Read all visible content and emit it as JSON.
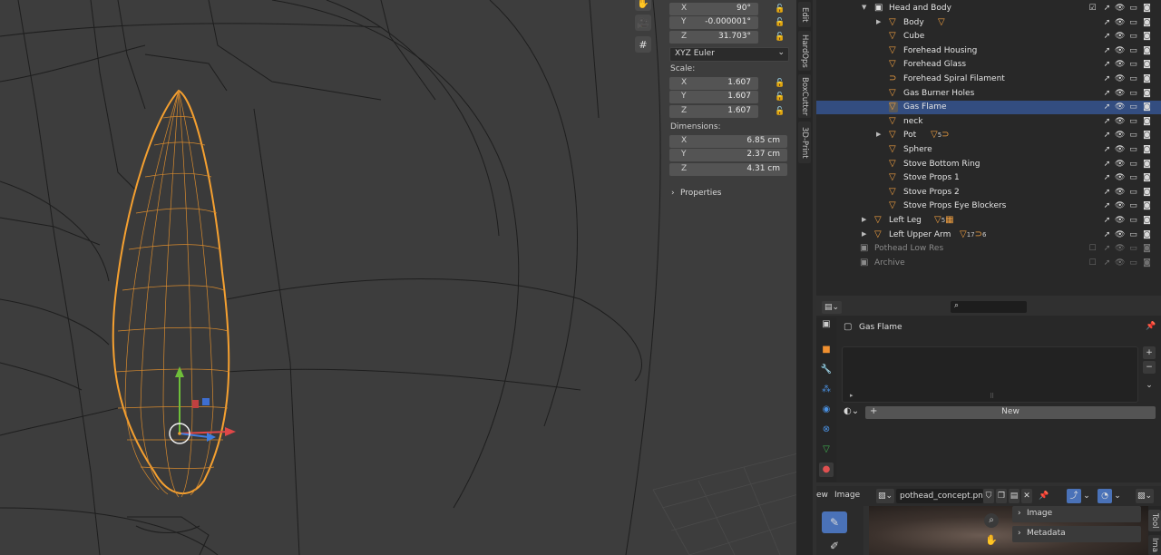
{
  "viewport": {
    "tool_icons": [
      "hand-icon",
      "camera-icon",
      "grid-icon"
    ]
  },
  "npanel": {
    "rotation": [
      {
        "axis": "X",
        "value": "90°"
      },
      {
        "axis": "Y",
        "value": "-0.000001°"
      },
      {
        "axis": "Z",
        "value": "31.703°"
      }
    ],
    "rotation_mode": "XYZ Euler",
    "scale_label": "Scale:",
    "scale": [
      {
        "axis": "X",
        "value": "1.607"
      },
      {
        "axis": "Y",
        "value": "1.607"
      },
      {
        "axis": "Z",
        "value": "1.607"
      }
    ],
    "dimensions_label": "Dimensions:",
    "dimensions": [
      {
        "axis": "X",
        "value": "6.85 cm"
      },
      {
        "axis": "Y",
        "value": "2.37 cm"
      },
      {
        "axis": "Z",
        "value": "4.31 cm"
      }
    ],
    "properties_label": "Properties"
  },
  "sidetabs": [
    "Edit",
    "HardOps",
    "BoxCutter",
    "3D-Print"
  ],
  "outliner": {
    "rows": [
      {
        "name": "Head and Body",
        "indent": 0,
        "type": "collection",
        "expanded": true,
        "selected": false,
        "dim": false
      },
      {
        "name": "Body",
        "indent": 1,
        "type": "mesh",
        "expanded": false,
        "has_arrow": true,
        "badge": "mesh"
      },
      {
        "name": "Cube",
        "indent": 1,
        "type": "mesh"
      },
      {
        "name": "Forehead  Housing",
        "indent": 1,
        "type": "mesh"
      },
      {
        "name": "Forehead Glass",
        "indent": 1,
        "type": "mesh"
      },
      {
        "name": "Forehead Spiral Filament",
        "indent": 1,
        "type": "curve"
      },
      {
        "name": "Gas Burner Holes",
        "indent": 1,
        "type": "mesh"
      },
      {
        "name": "Gas Flame",
        "indent": 1,
        "type": "mesh",
        "selected": true
      },
      {
        "name": "neck",
        "indent": 1,
        "type": "mesh"
      },
      {
        "name": "Pot",
        "indent": 1,
        "type": "mesh",
        "has_arrow": true,
        "badge": "mesh5curve"
      },
      {
        "name": "Sphere",
        "indent": 1,
        "type": "mesh"
      },
      {
        "name": "Stove Bottom Ring",
        "indent": 1,
        "type": "mesh"
      },
      {
        "name": "Stove Props 1",
        "indent": 1,
        "type": "mesh"
      },
      {
        "name": "Stove Props 2",
        "indent": 1,
        "type": "mesh"
      },
      {
        "name": "Stove Props Eye Blockers",
        "indent": 1,
        "type": "mesh"
      },
      {
        "name": "Left Leg",
        "indent": 0,
        "type": "mesh",
        "has_arrow": true,
        "badge": "leg"
      },
      {
        "name": "Left Upper Arm",
        "indent": 0,
        "type": "mesh",
        "has_arrow": true,
        "badge": "arm"
      },
      {
        "name": "Pothead Low Res",
        "indent": -1,
        "type": "collection",
        "dim": true
      },
      {
        "name": "Archive",
        "indent": -1,
        "type": "collection",
        "dim": true
      }
    ],
    "badge_numbers": {
      "pot": "5",
      "leg": "5",
      "arm_a": "17",
      "arm_b": "6"
    }
  },
  "properties": {
    "object_name": "Gas Flame",
    "new_label": "New"
  },
  "image_editor": {
    "view_label": "ew",
    "image_menu": "Image",
    "filename": "pothead_concept.png",
    "panel_items": [
      "Image",
      "Metadata"
    ],
    "side_tabs": [
      "Tool",
      "Ima"
    ]
  },
  "colors": {
    "accent_orange": "#f2a040",
    "selection_blue": "#334d80",
    "viewport_bg": "#3d3d3d"
  }
}
